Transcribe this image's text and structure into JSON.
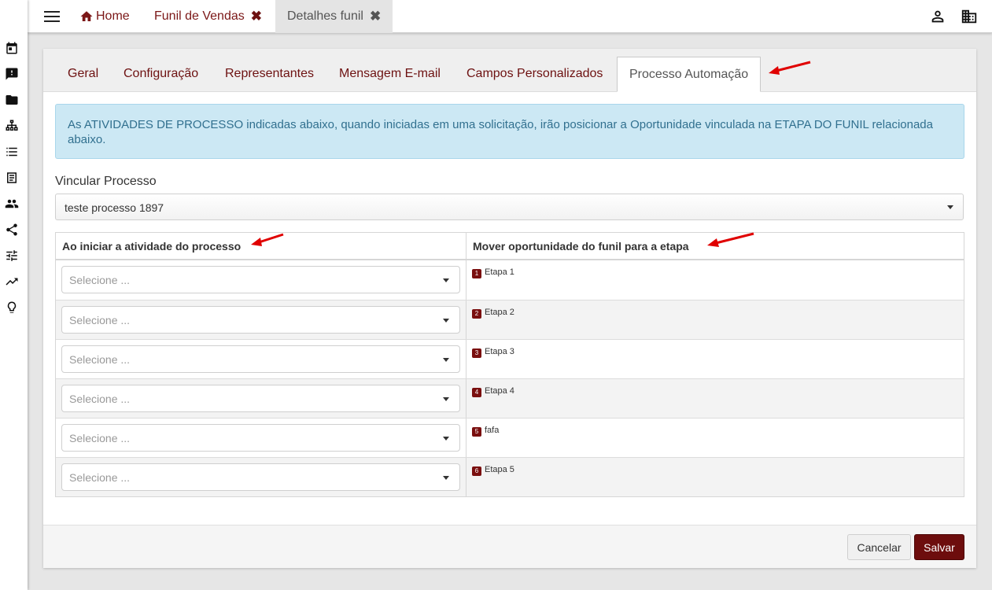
{
  "topbar": {
    "tabs": [
      {
        "label": "Home",
        "icon": "home-icon"
      },
      {
        "label": "Funil de Vendas",
        "close": "✖"
      },
      {
        "label": "Detalhes funil",
        "close": "✖"
      }
    ],
    "icons": [
      "user-icon",
      "building-icon"
    ]
  },
  "sidebar": {
    "icons": [
      "calendar-icon",
      "feedback-icon",
      "folder-icon",
      "sitemap-icon",
      "list-icon",
      "document-list-icon",
      "people-icon",
      "share-icon",
      "tune-icon",
      "trending-icon",
      "lightbulb-icon"
    ]
  },
  "tabs": [
    "Geral",
    "Configuração",
    "Representantes",
    "Mensagem E-mail",
    "Campos Personalizados",
    "Processo Automação"
  ],
  "active_tab": "Processo Automação",
  "info": "As ATIVIDADES DE PROCESSO indicadas abaixo, quando iniciadas em uma solicitação, irão posicionar a Oportunidade vinculada na ETAPA DO FUNIL relacionada abaixo.",
  "vincular": {
    "label": "Vincular Processo",
    "value": "teste processo 1897"
  },
  "table": {
    "col1": "Ao iniciar a atividade do processo",
    "col2": "Mover oportunidade do funil para a etapa",
    "placeholder": "Selecione ...",
    "rows": [
      {
        "num": "1",
        "stage": "Etapa 1"
      },
      {
        "num": "2",
        "stage": "Etapa 2"
      },
      {
        "num": "3",
        "stage": "Etapa 3"
      },
      {
        "num": "4",
        "stage": "Etapa 4"
      },
      {
        "num": "5",
        "stage": "fafa"
      },
      {
        "num": "6",
        "stage": "Etapa 5"
      }
    ]
  },
  "buttons": {
    "cancel": "Cancelar",
    "save": "Salvar"
  },
  "colors": {
    "brand": "#6d0d0d",
    "info_bg": "#cce8f4",
    "info_text": "#31708f",
    "annotation_arrow": "#e00000"
  }
}
